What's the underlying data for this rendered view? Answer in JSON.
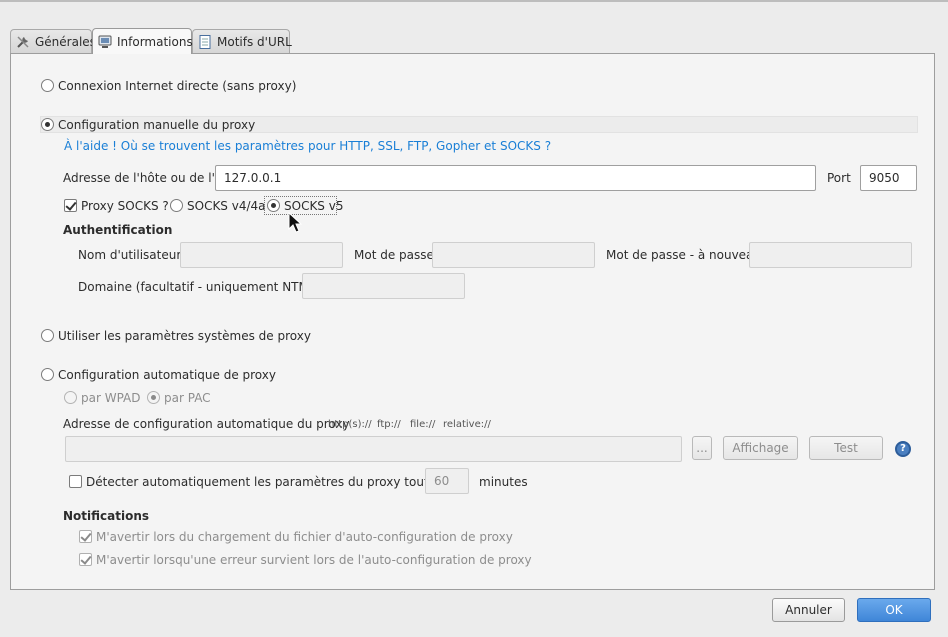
{
  "tabs": [
    {
      "label": "Générales",
      "icon": "tools-icon"
    },
    {
      "label": "Informations",
      "icon": "computer-icon"
    },
    {
      "label": "Motifs d'URL",
      "icon": "document-icon"
    }
  ],
  "direct": {
    "label": "Connexion Internet directe (sans proxy)",
    "selected": false
  },
  "manual": {
    "label": "Configuration manuelle du proxy",
    "selected": true,
    "help_link": "À l'aide ! Où se trouvent les paramètres pour HTTP, SSL, FTP, Gopher et SOCKS ?",
    "host_label": "Adresse de l'hôte ou de l'IP",
    "host_value": "127.0.0.1",
    "port_label": "Port",
    "port_value": "9050",
    "socks_label": "Proxy SOCKS ?",
    "socks_checked": true,
    "socks_v4_label": "SOCKS v4/4a",
    "socks_v5_label": "SOCKS v5",
    "socks_version": "v5",
    "auth_title": "Authentification",
    "username_label": "Nom d'utilisateur",
    "password_label": "Mot de passe",
    "password_again_label": "Mot de passe - à nouveau",
    "domain_label": "Domaine (facultatif - uniquement NTML)"
  },
  "system": {
    "label": "Utiliser les paramètres systèmes de proxy",
    "selected": false
  },
  "auto": {
    "label": "Configuration automatique de proxy",
    "selected": false,
    "wpad_label": "par WPAD",
    "pac_label": "par PAC",
    "pac_selected": true,
    "address_label": "Adresse de configuration automatique du proxy",
    "schemes": [
      "http(s)://",
      "ftp://",
      "file://",
      "relative://"
    ],
    "browse_label": "...",
    "view_label": "Affichage",
    "test_label": "Test",
    "detect_label": "Détecter automatiquement les paramètres du proxy toutes les",
    "detect_checked": false,
    "minutes_value": "60",
    "minutes_label": "minutes"
  },
  "notifications": {
    "title": "Notifications",
    "load_label": "M'avertir lors du chargement du fichier d'auto-configuration de proxy",
    "load_checked": true,
    "error_label": "M'avertir lorsqu'une erreur survient lors de l'auto-configuration de proxy",
    "error_checked": true
  },
  "footer": {
    "cancel_label": "Annuler",
    "ok_label": "OK"
  },
  "colors": {
    "link": "#1a7fd6",
    "ok_button": "#3f86d8",
    "help_icon": "#4a7fc0"
  }
}
